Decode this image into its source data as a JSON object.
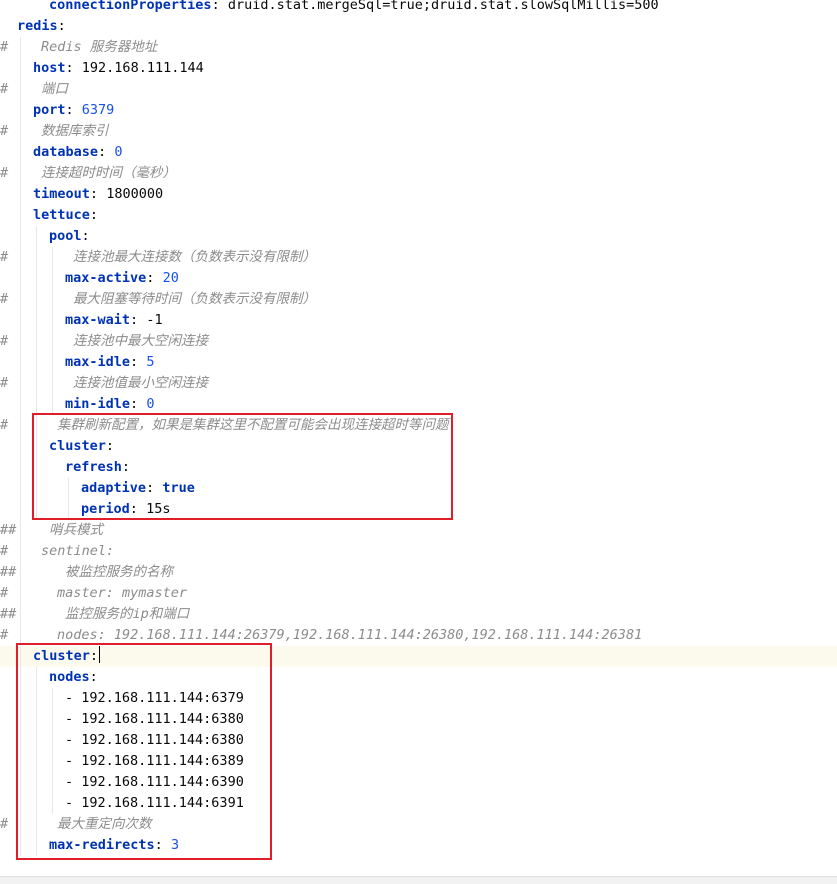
{
  "lines": [
    {
      "gutter": "",
      "key": "connectionProperties",
      "value": "druid.stat.mergeSql=true;druid.stat.slowSqlMillis=500",
      "vtype": "str"
    },
    {
      "gutter": "",
      "key": "redis",
      "value": "",
      "vtype": "str"
    },
    {
      "gutter": "#",
      "comment": "Redis 服务器地址"
    },
    {
      "gutter": "",
      "key": "host",
      "value": "192.168.111.144",
      "vtype": "str"
    },
    {
      "gutter": "#",
      "comment": "端口"
    },
    {
      "gutter": "",
      "key": "port",
      "value": "6379",
      "vtype": "num"
    },
    {
      "gutter": "#",
      "comment": "数据库索引"
    },
    {
      "gutter": "",
      "key": "database",
      "value": "0",
      "vtype": "num"
    },
    {
      "gutter": "#",
      "comment": "连接超时时间（毫秒）"
    },
    {
      "gutter": "",
      "key": "timeout",
      "value": "1800000",
      "vtype": "str"
    },
    {
      "gutter": "",
      "key": "lettuce",
      "value": "",
      "vtype": "str"
    },
    {
      "gutter": "",
      "key": "pool",
      "value": "",
      "vtype": "str"
    },
    {
      "gutter": "#",
      "comment": "连接池最大连接数（负数表示没有限制）"
    },
    {
      "gutter": "",
      "key": "max-active",
      "value": "20",
      "vtype": "num"
    },
    {
      "gutter": "#",
      "comment": "最大阻塞等待时间（负数表示没有限制）"
    },
    {
      "gutter": "",
      "key": "max-wait",
      "value": "-1",
      "vtype": "str"
    },
    {
      "gutter": "#",
      "comment": "连接池中最大空闲连接"
    },
    {
      "gutter": "",
      "key": "max-idle",
      "value": "5",
      "vtype": "num"
    },
    {
      "gutter": "#",
      "comment": "连接池值最小空闲连接"
    },
    {
      "gutter": "",
      "key": "min-idle",
      "value": "0",
      "vtype": "num"
    },
    {
      "gutter": "#",
      "comment": "集群刷新配置，如果是集群这里不配置可能会出现连接超时等问题"
    },
    {
      "gutter": "",
      "key": "cluster",
      "value": "",
      "vtype": "str"
    },
    {
      "gutter": "",
      "key": "refresh",
      "value": "",
      "vtype": "str"
    },
    {
      "gutter": "",
      "key": "adaptive",
      "value": "true",
      "vtype": "bool"
    },
    {
      "gutter": "",
      "key": "period",
      "value": "15s",
      "vtype": "str"
    },
    {
      "gutter": "##",
      "comment": "哨兵模式"
    },
    {
      "gutter": "#",
      "comment": "sentinel:"
    },
    {
      "gutter": "##",
      "comment": "被监控服务的名称"
    },
    {
      "gutter": "#",
      "comment": "master: mymaster"
    },
    {
      "gutter": "##",
      "comment": "监控服务的ip和端口"
    },
    {
      "gutter": "#",
      "comment": "nodes: 192.168.111.144:26379,192.168.111.144:26380,192.168.111.144:26381"
    },
    {
      "gutter": "",
      "key": "cluster",
      "value": "",
      "vtype": "str"
    },
    {
      "gutter": "",
      "key": "nodes",
      "value": "",
      "vtype": "str"
    },
    {
      "gutter": "",
      "item": "192.168.111.144:6379"
    },
    {
      "gutter": "",
      "item": "192.168.111.144:6380"
    },
    {
      "gutter": "",
      "item": "192.168.111.144:6380"
    },
    {
      "gutter": "",
      "item": "192.168.111.144:6389"
    },
    {
      "gutter": "",
      "item": "192.168.111.144:6390"
    },
    {
      "gutter": "",
      "item": "192.168.111.144:6391"
    },
    {
      "gutter": "#",
      "comment": "最大重定向次数"
    },
    {
      "gutter": "",
      "key": "max-redirects",
      "value": "3",
      "vtype": "num"
    }
  ],
  "colors": {
    "highlight_box": "#e11d2a",
    "key": "#0033b3",
    "number": "#1750eb",
    "comment": "#8c8c8c",
    "current_line": "#fcfaed"
  }
}
